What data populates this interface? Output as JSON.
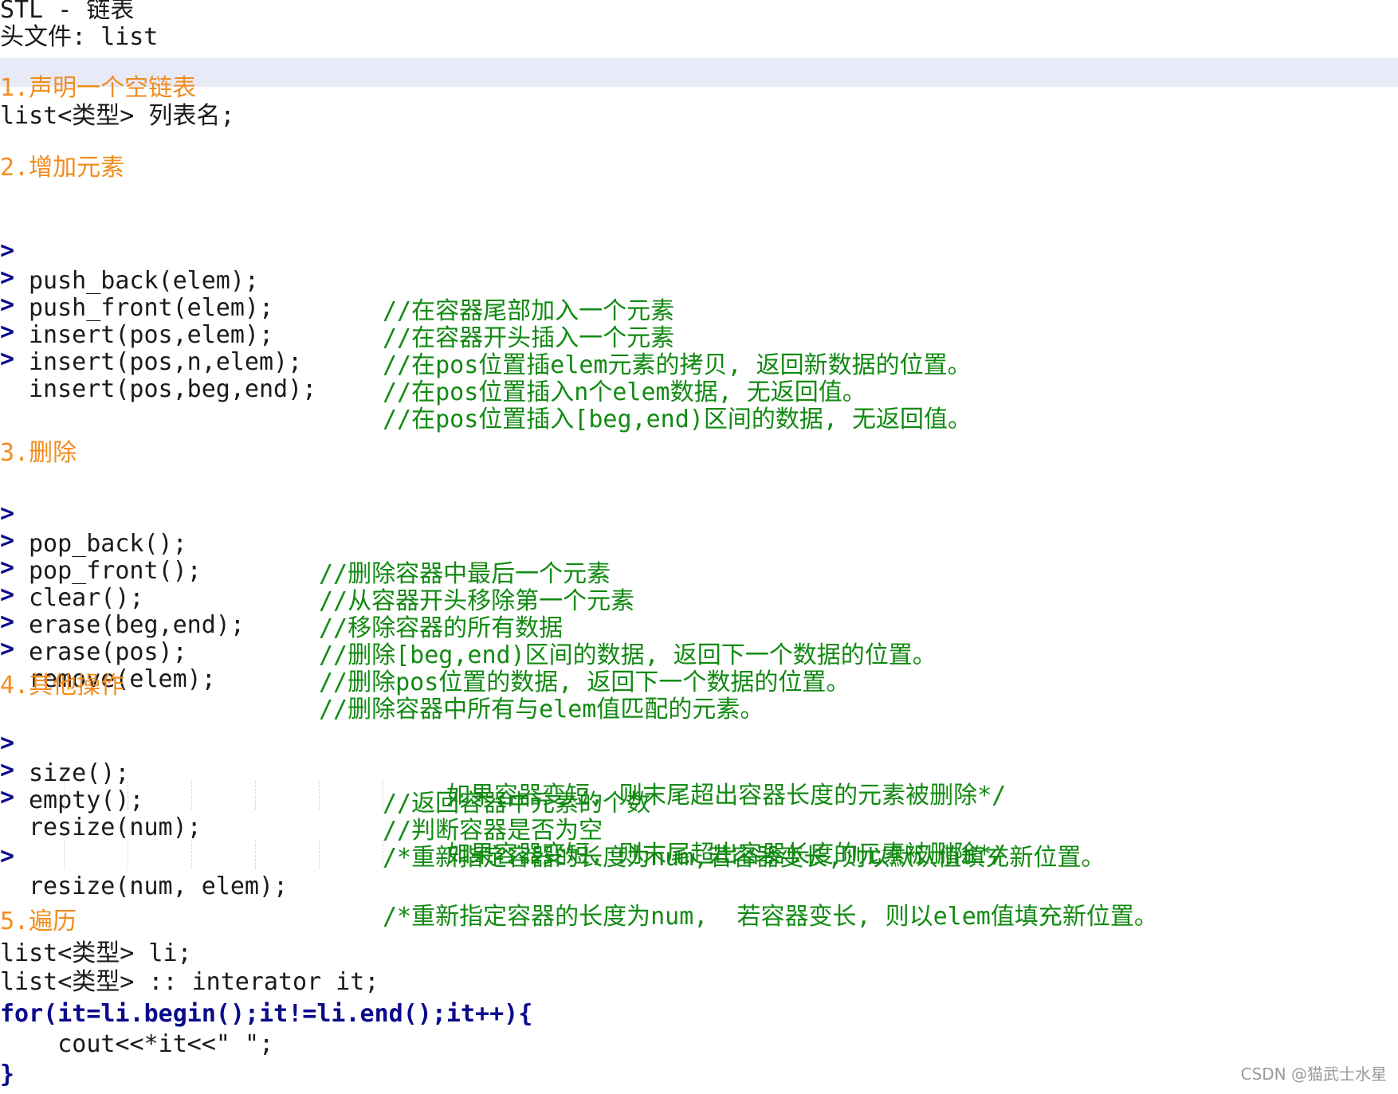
{
  "title_line": "STL - 链表",
  "header_line": "头文件: list",
  "s1": {
    "heading": "1.声明一个空链表",
    "code": "list<类型> 列表名;"
  },
  "s2": {
    "heading": "2.增加元素",
    "items": [
      {
        "marker": ">",
        "code": "push_back(elem);",
        "comment": "//在容器尾部加入一个元素"
      },
      {
        "marker": ">",
        "code": "push_front(elem);",
        "comment": "//在容器开头插入一个元素"
      },
      {
        "marker": ">",
        "code": "insert(pos,elem);",
        "comment": "//在pos位置插elem元素的拷贝, 返回新数据的位置。"
      },
      {
        "marker": ">",
        "code": "insert(pos,n,elem);",
        "comment": "//在pos位置插入n个elem数据, 无返回值。"
      },
      {
        "marker": ">",
        "code": "insert(pos,beg,end);",
        "comment": "//在pos位置插入[beg,end)区间的数据, 无返回值。"
      }
    ]
  },
  "s3": {
    "heading": "3.删除",
    "items": [
      {
        "marker": ">",
        "code": "pop_back();",
        "comment": "//删除容器中最后一个元素"
      },
      {
        "marker": ">",
        "code": "pop_front();",
        "comment": "//从容器开头移除第一个元素"
      },
      {
        "marker": ">",
        "code": "clear();",
        "comment": "//移除容器的所有数据"
      },
      {
        "marker": ">",
        "code": "erase(beg,end);",
        "comment": "//删除[beg,end)区间的数据, 返回下一个数据的位置。"
      },
      {
        "marker": ">",
        "code": "erase(pos);",
        "comment": "//删除pos位置的数据, 返回下一个数据的位置。"
      },
      {
        "marker": ">",
        "code": "remove(elem);",
        "comment": "//删除容器中所有与elem值匹配的元素。"
      }
    ]
  },
  "s4": {
    "heading": "4.其他操作",
    "items": [
      {
        "marker": ">",
        "code": "size();",
        "comment": "//返回容器中元素的个数"
      },
      {
        "marker": ">",
        "code": "empty();",
        "comment": "//判断容器是否为空"
      },
      {
        "marker": ">",
        "code": "resize(num);",
        "comment": "/*重新指定容器的长度为num,若容器变长,则以默认值填充新位置。",
        "comment2": "如果容器变短, 则末尾超出容器长度的元素被删除*/"
      },
      {
        "marker": ">",
        "code": "resize(num, elem);",
        "comment": "/*重新指定容器的长度为num,  若容器变长, 则以elem值填充新位置。",
        "comment2": "如果容器变短, 则末尾超出容器长度的元素被删除*/"
      }
    ]
  },
  "s5": {
    "heading": "5.遍历",
    "lines": [
      "list<类型> li;",
      "list<类型> :: interator it;",
      "for(it=li.begin();it!=li.end();it++){",
      "    cout<<*it<<\" \";",
      "}"
    ]
  },
  "watermark": "CSDN @猫武士水星"
}
